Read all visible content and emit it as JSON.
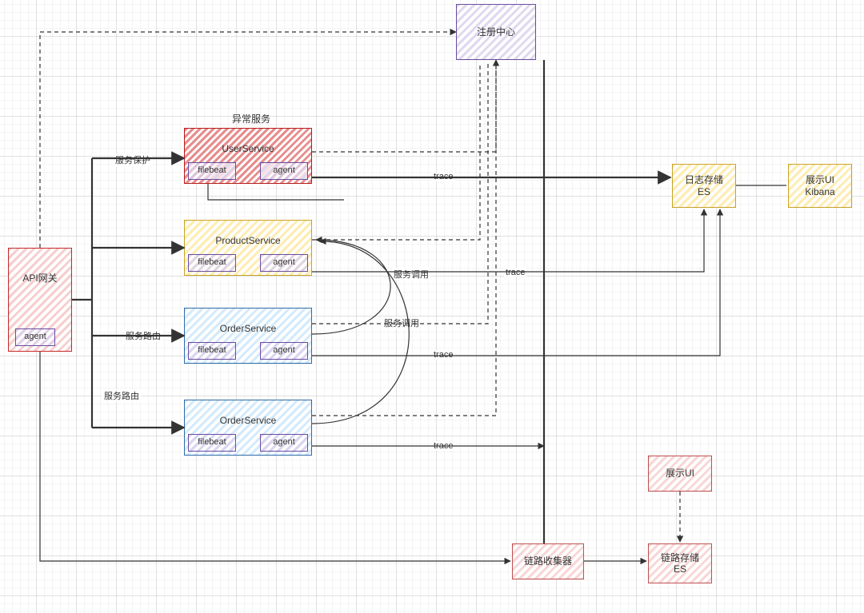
{
  "nodes": {
    "api_gateway": {
      "label": "API网关",
      "sub_agent": "agent"
    },
    "registry": {
      "label": "注册中心"
    },
    "user_service": {
      "title": "异常服务",
      "label": "UserService",
      "filebeat": "filebeat",
      "agent": "agent"
    },
    "product_service": {
      "label": "ProductService",
      "filebeat": "filebeat",
      "agent": "agent"
    },
    "order_service_1": {
      "label": "OrderService",
      "filebeat": "filebeat",
      "agent": "agent"
    },
    "order_service_2": {
      "label": "OrderService",
      "filebeat": "filebeat",
      "agent": "agent"
    },
    "log_store": {
      "label": "日志存储\nES"
    },
    "ui_kibana": {
      "label": "展示UI\nKibana"
    },
    "trace_collector": {
      "label": "链路收集器"
    },
    "trace_store": {
      "label": "链路存储\nES"
    },
    "ui_trace": {
      "label": "展示UI"
    }
  },
  "edge_labels": {
    "service_protect": "服务保护",
    "service_route_1": "服务路由",
    "service_route_2": "服务路由",
    "service_call_1": "服务调用",
    "service_call_2": "服务调用",
    "trace_1": "trace",
    "trace_2": "trace",
    "trace_3": "trace",
    "trace_4": "trace"
  },
  "colors": {
    "red": "#c62828",
    "yellow": "#c9a227",
    "blue": "#2f6aa8",
    "purple": "#6a4ca0",
    "pink": "#c05050"
  }
}
